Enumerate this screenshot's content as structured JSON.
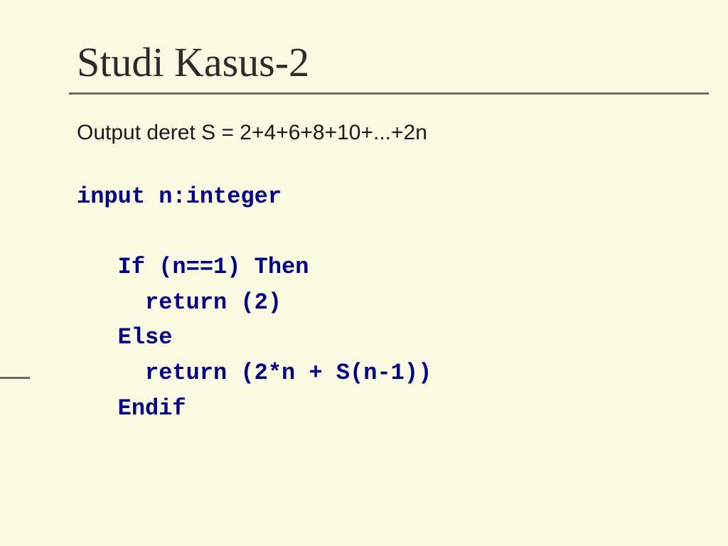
{
  "slide": {
    "title": "Studi Kasus-2",
    "description": "Output deret S = 2+4+6+8+10+...+2n",
    "code": {
      "l1": "input n:integer",
      "l2": "",
      "l3": "   If (n==1) Then",
      "l4": "     return (2)",
      "l5": "   Else",
      "l6": "     return (2*n + S(n-1))",
      "l7": "   Endif"
    }
  }
}
